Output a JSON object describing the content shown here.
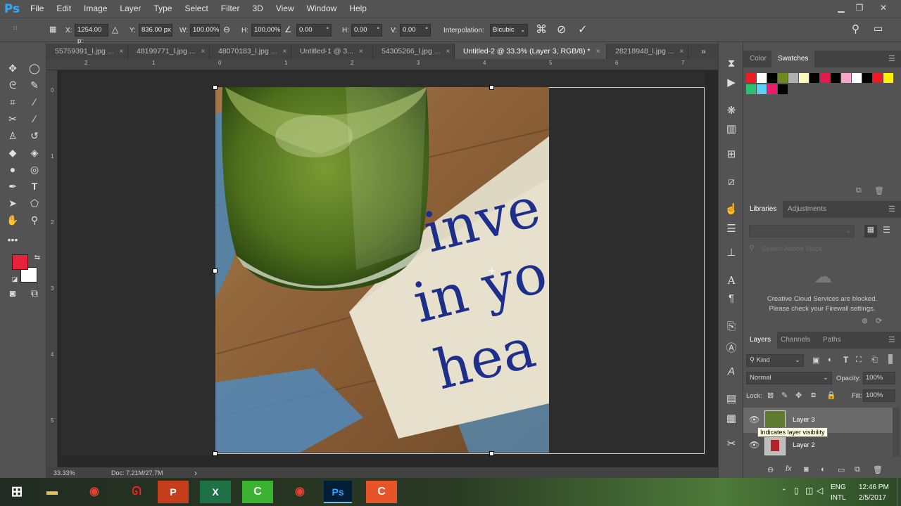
{
  "app": {
    "logo": "Ps"
  },
  "menu": [
    "File",
    "Edit",
    "Image",
    "Layer",
    "Type",
    "Select",
    "Filter",
    "3D",
    "View",
    "Window",
    "Help"
  ],
  "window_controls": {
    "minimize": "▁",
    "restore": "❐",
    "close": "✕"
  },
  "options": {
    "x_label": "X:",
    "x_value": "1254.00 p:",
    "y_label": "Y:",
    "y_value": "836.00 px",
    "w_label": "W:",
    "w_value": "100.00%",
    "h_label": "H:",
    "h_value": "100.00%",
    "angle_value": "0.00",
    "angle_unit": "°",
    "hskew_label": "H:",
    "hskew_value": "0.00",
    "hskew_unit": "°",
    "vskew_label": "V:",
    "vskew_value": "0.00",
    "vskew_unit": "°",
    "interp_label": "Interpolation:",
    "interp_value": "Bicubic"
  },
  "tabs": [
    {
      "label": "55759391_l.jpg ...",
      "close": "×"
    },
    {
      "label": "48199771_l.jpg ...",
      "close": "×"
    },
    {
      "label": "48070183_l.jpg ...",
      "close": "×"
    },
    {
      "label": "Untitled-1 @ 3...",
      "close": "×"
    },
    {
      "label": "54305266_l.jpg ...",
      "close": "×"
    },
    {
      "label": "Untitled-2 @ 33.3% (Layer 3, RGB/8) *",
      "close": "×"
    },
    {
      "label": "28218948_l.jpg ...",
      "close": "×"
    }
  ],
  "tabs_overflow": "»",
  "ruler_top": [
    "2",
    "1",
    "0",
    "1",
    "2",
    "3",
    "4",
    "5",
    "6",
    "7"
  ],
  "ruler_left": [
    "0",
    "1",
    "2",
    "3",
    "4",
    "5"
  ],
  "status": {
    "zoom": "33.33%",
    "doc": "Doc: 7.21M/27.7M",
    "arrow": "›"
  },
  "photo": {
    "napkin_text": [
      "inve",
      "in yo",
      "hea"
    ]
  },
  "colors": {
    "foreground": "#e8223a",
    "background": "#ffffff",
    "accent": "#31a8ff"
  },
  "swatches_panel": {
    "tabs": [
      "Color",
      "Swatches"
    ],
    "swatches": [
      "#ed1c24",
      "#ffffff",
      "#000000",
      "#6d8b1a",
      "#b0b0b0",
      "#fff5c0",
      "#000000",
      "#e6194b",
      "#000000",
      "#f4a6c6",
      "#ffffff",
      "#000000",
      "#ed1c24",
      "#fff200",
      "#2fbf71",
      "#5bd0f5",
      "#ed1c6a",
      "#000000"
    ]
  },
  "libraries_panel": {
    "tabs": [
      "Libraries",
      "Adjustments"
    ],
    "search_placeholder": "Search Adobe Stock",
    "blocked_line1": "Creative Cloud Services are blocked.",
    "blocked_line2": "Please check your Firewall settings."
  },
  "layers_panel": {
    "tabs": [
      "Layers",
      "Channels",
      "Paths"
    ],
    "filter_value": "Kind",
    "blend_mode": "Normal",
    "opacity_label": "Opacity:",
    "opacity_value": "100%",
    "lock_label": "Lock:",
    "fill_label": "Fill:",
    "fill_value": "100%",
    "layers": [
      "Layer 3",
      "Layer 2"
    ],
    "tooltip": "Indicates layer visibility"
  },
  "taskbar": {
    "apps": [
      "Explorer",
      "Chrome",
      "Airtel",
      "PowerPoint",
      "Excel",
      "Camtasia",
      "Chrome",
      "Photoshop",
      "Camtasia Recorder"
    ],
    "lang1": "ENG",
    "lang2": "INTL",
    "time": "12:46 PM",
    "date": "2/5/2017"
  }
}
